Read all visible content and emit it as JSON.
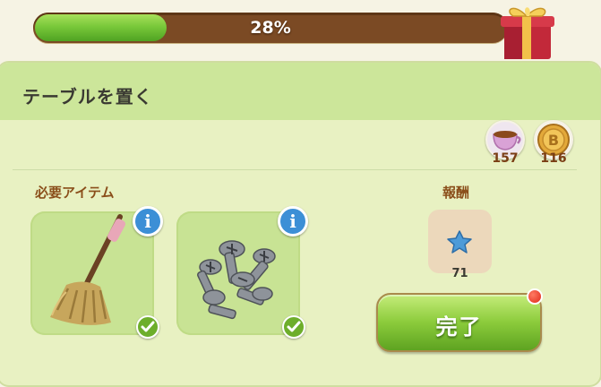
{
  "progress": {
    "value": 0.28,
    "label": "28%"
  },
  "quest": {
    "title": "テーブルを置く"
  },
  "resources": [
    {
      "icon": "teacup-icon",
      "count": "157"
    },
    {
      "icon": "gold-coin-icon",
      "count": "116"
    }
  ],
  "required": {
    "label": "必要アイテム",
    "items": [
      {
        "icon": "mop-icon",
        "complete": true
      },
      {
        "icon": "screws-icon",
        "complete": true
      }
    ]
  },
  "reward": {
    "label": "報酬",
    "icon": "blue-star-icon",
    "count": "71"
  },
  "complete_button": {
    "label": "完了"
  },
  "colors": {
    "progress_fill": "#79c83a",
    "bar_track": "#7b4a24",
    "info": "#3c8fd6",
    "check": "#6dae2b",
    "notify": "#e02a1a"
  }
}
